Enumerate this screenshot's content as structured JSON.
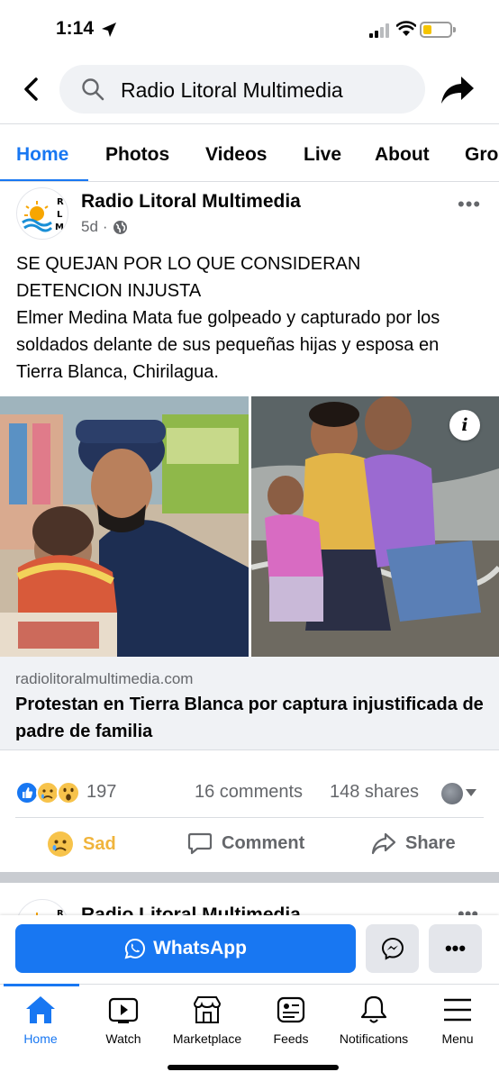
{
  "status_bar": {
    "time": "1:14"
  },
  "search": {
    "query": "Radio Litoral Multimedia"
  },
  "tabs": [
    "Home",
    "Photos",
    "Videos",
    "Live",
    "About",
    "Gro"
  ],
  "post": {
    "page_name": "Radio Litoral Multimedia",
    "time": "5d",
    "avatar_letters": [
      "R",
      "L",
      "M"
    ],
    "text_line1": "SE QUEJAN POR LO QUE CONSIDERAN",
    "text_line2": "DETENCION INJUSTA",
    "text_body": "Elmer Medina Mata fue golpeado y capturado por los soldados delante de sus pequeñas hijas y esposa en Tierra Blanca, Chirilagua.",
    "link_domain": "radiolitoralmultimedia.com",
    "link_title": "Protestan en Tierra Blanca por captura injustificada de padre de familia",
    "reactions_count": "197",
    "comments": "16 comments",
    "shares": "148 shares"
  },
  "actions": {
    "sad": "Sad",
    "comment": "Comment",
    "share": "Share"
  },
  "next_post": {
    "page_name": "Radio Litoral Multimedia"
  },
  "cta": {
    "whatsapp": "WhatsApp"
  },
  "bottom_nav": {
    "home": "Home",
    "watch": "Watch",
    "marketplace": "Marketplace",
    "feeds": "Feeds",
    "notifications": "Notifications",
    "menu": "Menu"
  },
  "colors": {
    "accent": "#1877f2",
    "sad": "#f0b43c",
    "battery": "#f5c400"
  }
}
